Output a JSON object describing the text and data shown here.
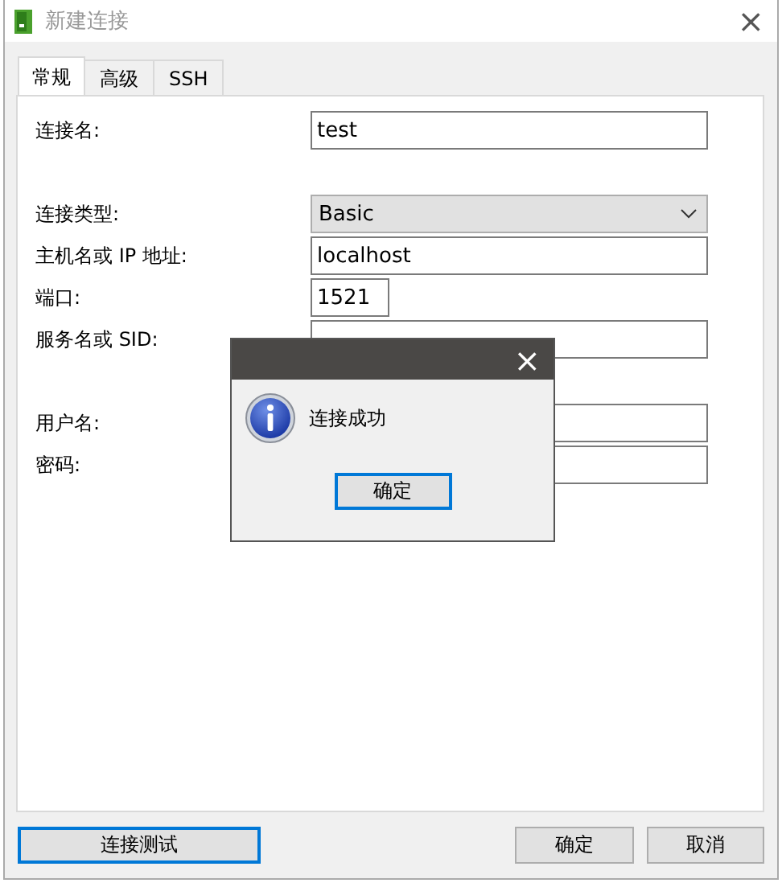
{
  "window": {
    "title": "新建连接",
    "close": "×"
  },
  "tabs": [
    {
      "label": "常规",
      "selected": true
    },
    {
      "label": "高级",
      "selected": false
    },
    {
      "label": "SSH",
      "selected": false
    }
  ],
  "form": [
    {
      "kind": "text",
      "label": "连接名:",
      "value": "test"
    },
    {
      "kind": "select",
      "label": "连接类型:",
      "value": "Basic"
    },
    {
      "kind": "text",
      "label": "主机名或 IP 地址:",
      "value": "localhost"
    },
    {
      "kind": "number",
      "label": "端口:",
      "value": "1521"
    },
    {
      "kind": "text",
      "label": "服务名或 SID:"
    },
    {
      "kind": "text",
      "label": "用户名:"
    },
    {
      "kind": "password",
      "label": "密码:"
    }
  ],
  "buttons": [
    {
      "label": "连接测试",
      "focused": true
    },
    {
      "label": "确定",
      "focused": false
    },
    {
      "label": "取消",
      "focused": false
    }
  ],
  "dialog": {
    "close": "×",
    "message": "连接成功",
    "button": {
      "label": "确定",
      "focused": true
    }
  }
}
